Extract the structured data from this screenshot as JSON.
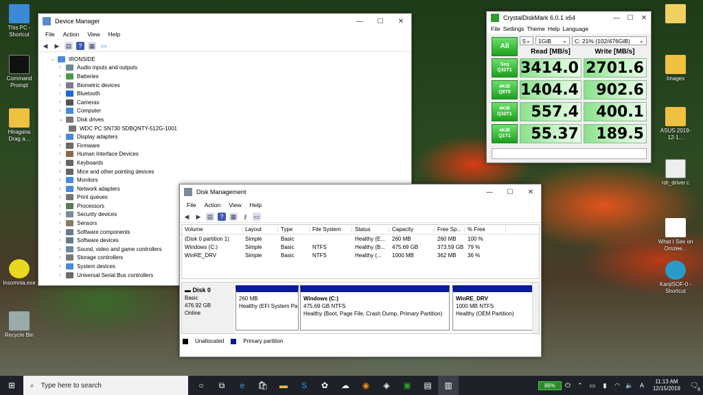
{
  "desktop": {
    "icons_left": [
      {
        "label": "This PC - Shortcut",
        "color": "#3a8ad8"
      },
      {
        "label": "Command Prompt",
        "color": "#111"
      },
      {
        "label": "Hiragana Drag a...",
        "color": "#f0c040"
      },
      {
        "label": "Insomnia.exe",
        "color": "#e8d820"
      },
      {
        "label": "Recycle Bin",
        "color": "#9aa"
      }
    ],
    "icons_right": [
      {
        "label": "",
        "color": "#f0d060"
      },
      {
        "label": "Images",
        "color": "#f0c040"
      },
      {
        "label": "ASUS 2019-12-1...",
        "color": "#f0c040"
      },
      {
        "label": "rdr_driver.c",
        "color": "#eee"
      },
      {
        "label": "What I See on Omzee...",
        "color": "#fff"
      },
      {
        "label": "KanjiSOF-0 - Shortcut",
        "color": "#2a9ac8"
      }
    ]
  },
  "device_manager": {
    "title": "Device Manager",
    "menu": [
      "File",
      "Action",
      "View",
      "Help"
    ],
    "root": "IRONSIDE",
    "items": [
      {
        "label": "Audio inputs and outputs",
        "expanded": false,
        "color": "#6a8a9a"
      },
      {
        "label": "Batteries",
        "expanded": false,
        "color": "#4a9a4a"
      },
      {
        "label": "Biometric devices",
        "expanded": false,
        "color": "#7a7a9a"
      },
      {
        "label": "Bluetooth",
        "expanded": false,
        "color": "#1a6ad8"
      },
      {
        "label": "Cameras",
        "expanded": false,
        "color": "#555"
      },
      {
        "label": "Computer",
        "expanded": false,
        "color": "#4a8ad8"
      },
      {
        "label": "Disk drives",
        "expanded": true,
        "color": "#777"
      },
      {
        "label": "WDC PC SN730 SDBQNTY-512G-1001",
        "child": true,
        "color": "#777"
      },
      {
        "label": "Display adapters",
        "expanded": false,
        "color": "#4a8ad8"
      },
      {
        "label": "Firmware",
        "expanded": false,
        "color": "#6a6a6a"
      },
      {
        "label": "Human Interface Devices",
        "expanded": false,
        "color": "#8a6a4a"
      },
      {
        "label": "Keyboards",
        "expanded": false,
        "color": "#666"
      },
      {
        "label": "Mice and other pointing devices",
        "expanded": false,
        "color": "#666"
      },
      {
        "label": "Monitors",
        "expanded": false,
        "color": "#4a8ad8"
      },
      {
        "label": "Network adapters",
        "expanded": false,
        "color": "#4a8ad8"
      },
      {
        "label": "Print queues",
        "expanded": false,
        "color": "#777"
      },
      {
        "label": "Processors",
        "expanded": false,
        "color": "#5a7a5a"
      },
      {
        "label": "Security devices",
        "expanded": false,
        "color": "#7a8a9a"
      },
      {
        "label": "Sensors",
        "expanded": false,
        "color": "#8a7a5a"
      },
      {
        "label": "Software components",
        "expanded": false,
        "color": "#6a7a8a"
      },
      {
        "label": "Software devices",
        "expanded": false,
        "color": "#6a7a8a"
      },
      {
        "label": "Sound, video and game controllers",
        "expanded": false,
        "color": "#6a8a9a"
      },
      {
        "label": "Storage controllers",
        "expanded": false,
        "color": "#7a7a7a"
      },
      {
        "label": "System devices",
        "expanded": false,
        "color": "#4a8ad8"
      },
      {
        "label": "Universal Serial Bus controllers",
        "expanded": false,
        "color": "#6a6a6a"
      }
    ]
  },
  "cdm": {
    "title": "CrystalDiskMark 6.0.1 x64",
    "menu": [
      "File",
      "Settings",
      "Theme",
      "Help",
      "Language"
    ],
    "all_label": "All",
    "count": "5",
    "size": "1GiB",
    "drive": "C: 21% (102/476GiB)",
    "read_header": "Read [MB/s]",
    "write_header": "Write [MB/s]",
    "rows": [
      {
        "l1": "Seq",
        "l2": "Q32T1",
        "read": "3414.0",
        "write": "2701.6"
      },
      {
        "l1": "4KiB",
        "l2": "Q8T8",
        "read": "1404.4",
        "write": "902.6"
      },
      {
        "l1": "4KiB",
        "l2": "Q32T1",
        "read": "557.4",
        "write": "400.1"
      },
      {
        "l1": "4KiB",
        "l2": "Q1T1",
        "read": "55.37",
        "write": "189.5"
      }
    ]
  },
  "disk_mgmt": {
    "title": "Disk Management",
    "menu": [
      "File",
      "Action",
      "View",
      "Help"
    ],
    "columns": [
      "Volume",
      "Layout",
      "Type",
      "File System",
      "Status",
      "Capacity",
      "Free Sp...",
      "% Free"
    ],
    "rows": [
      [
        "(Disk 0 partition 1)",
        "Simple",
        "Basic",
        "",
        "Healthy (E...",
        "260 MB",
        "260 MB",
        "100 %"
      ],
      [
        "Windows (C:)",
        "Simple",
        "Basic",
        "NTFS",
        "Healthy (B...",
        "475.69 GB",
        "373.59 GB",
        "79 %"
      ],
      [
        "WinRE_DRV",
        "Simple",
        "Basic",
        "NTFS",
        "Healthy (...",
        "1000 MB",
        "362 MB",
        "36 %"
      ]
    ],
    "disk": {
      "name": "Disk 0",
      "type": "Basic",
      "size": "476.92 GB",
      "state": "Online"
    },
    "partitions": [
      {
        "name": "",
        "size": "260 MB",
        "status": "Healthy (EFI System Pa"
      },
      {
        "name": "Windows  (C:)",
        "size": "475.69 GB NTFS",
        "status": "Healthy (Boot, Page File, Crash Dump, Primary Partition)"
      },
      {
        "name": "WinRE_DRV",
        "size": "1000 MB NTFS",
        "status": "Healthy (OEM Partition)"
      }
    ],
    "legend": [
      "Unallocated",
      "Primary partition"
    ]
  },
  "taskbar": {
    "search_placeholder": "Type here to search",
    "battery": "89%",
    "time": "11:13 AM",
    "date": "12/15/2019",
    "notif_count": "6"
  }
}
